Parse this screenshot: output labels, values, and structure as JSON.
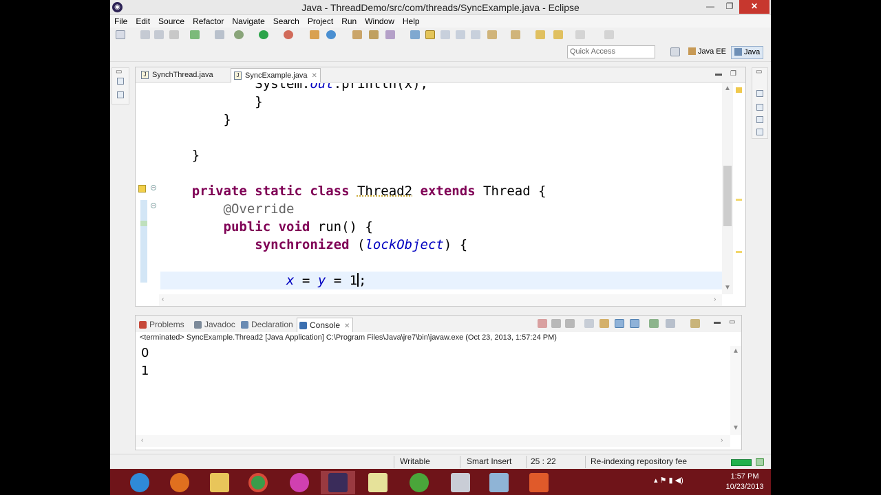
{
  "window": {
    "title": "Java - ThreadDemo/src/com/threads/SyncExample.java - Eclipse",
    "minimize": "—",
    "maximize": "❐",
    "close": "✕"
  },
  "menu": [
    "File",
    "Edit",
    "Source",
    "Refactor",
    "Navigate",
    "Search",
    "Project",
    "Run",
    "Window",
    "Help"
  ],
  "toolbar": {
    "quick_access_placeholder": "Quick Access",
    "perspectives": [
      {
        "label": "Java EE",
        "active": false
      },
      {
        "label": "Java",
        "active": true
      }
    ]
  },
  "editor": {
    "tabs": [
      {
        "label": "SynchThread.java",
        "active": false
      },
      {
        "label": "SyncExample.java",
        "active": true
      }
    ],
    "lines": [
      {
        "indent": "            ",
        "tokens": [
          {
            "t": "System.",
            "c": ""
          },
          {
            "t": "out",
            "c": "fld"
          },
          {
            "t": ".println(x);",
            "c": ""
          }
        ]
      },
      {
        "indent": "            ",
        "tokens": [
          {
            "t": "}",
            "c": ""
          }
        ]
      },
      {
        "indent": "        ",
        "tokens": [
          {
            "t": "}",
            "c": ""
          }
        ]
      },
      {
        "indent": "",
        "tokens": []
      },
      {
        "indent": "    ",
        "tokens": [
          {
            "t": "}",
            "c": ""
          }
        ]
      },
      {
        "indent": "",
        "tokens": []
      },
      {
        "indent": "    ",
        "tokens": [
          {
            "t": "private static class ",
            "c": "kw"
          },
          {
            "t": "Thread2",
            "c": "squig"
          },
          {
            "t": " extends ",
            "c": "kw"
          },
          {
            "t": "Thread {",
            "c": ""
          }
        ]
      },
      {
        "indent": "        ",
        "tokens": [
          {
            "t": "@Override",
            "c": "ann"
          }
        ]
      },
      {
        "indent": "        ",
        "tokens": [
          {
            "t": "public void ",
            "c": "kw"
          },
          {
            "t": "run() {",
            "c": ""
          }
        ]
      },
      {
        "indent": "            ",
        "tokens": [
          {
            "t": "synchronized ",
            "c": "kw"
          },
          {
            "t": "(",
            "c": ""
          },
          {
            "t": "lockObject",
            "c": "fld"
          },
          {
            "t": ") {",
            "c": ""
          }
        ]
      },
      {
        "indent": "",
        "tokens": []
      },
      {
        "indent": "                ",
        "tokens": [
          {
            "t": "x",
            "c": "fld"
          },
          {
            "t": " = ",
            "c": ""
          },
          {
            "t": "y",
            "c": "fld"
          },
          {
            "t": " = 1",
            "c": ""
          },
          {
            "t": "|",
            "c": "cursor"
          },
          {
            "t": ";",
            "c": ""
          }
        ],
        "current": true
      }
    ]
  },
  "console": {
    "tabs": [
      {
        "label": "Problems",
        "active": false,
        "color": "#c7493a"
      },
      {
        "label": "Javadoc",
        "active": false,
        "color": "#7c8a9a"
      },
      {
        "label": "Declaration",
        "active": false,
        "color": "#6a8bb3"
      },
      {
        "label": "Console",
        "active": true,
        "color": "#3b6fb0"
      }
    ],
    "terminated_text": "<terminated> SyncExample.Thread2 [Java Application] C:\\Program Files\\Java\\jre7\\bin\\javaw.exe (Oct 23, 2013, 1:57:24 PM)",
    "output": [
      "0",
      "1"
    ]
  },
  "status": {
    "writable": "Writable",
    "insert_mode": "Smart Insert",
    "position": "25 : 22",
    "task": "Re-indexing repository fee"
  },
  "taskbar": {
    "time": "1:57 PM",
    "date": "10/23/2013"
  }
}
